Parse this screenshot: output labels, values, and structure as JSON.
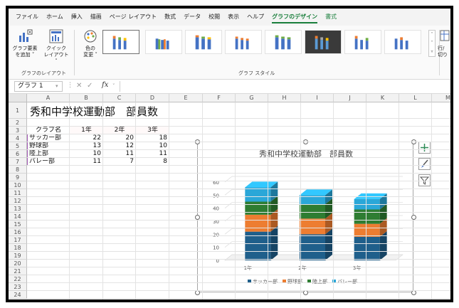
{
  "ribbon": {
    "tabs": [
      "ファイル",
      "ホーム",
      "挿入",
      "描画",
      "ページ レイアウト",
      "数式",
      "データ",
      "校閲",
      "表示",
      "ヘルプ",
      "グラフのデザイン",
      "書式"
    ],
    "active_tab": "グラフのデザイン",
    "buttons": {
      "add_element_l1": "グラフ要素",
      "add_element_l2": "を追加 ˅",
      "quick_layout_l1": "クイック",
      "quick_layout_l2": "レイアウト ˅",
      "change_color_l1": "色の",
      "change_color_l2": "変更 ˅",
      "switch_rowcol_l1": "行/",
      "switch_rowcol_l2": "切り"
    },
    "groups": {
      "layouts": "グラフのレイアウト",
      "styles": "グラフ スタイル"
    }
  },
  "formula_bar": {
    "name_box": "グラフ 1",
    "fx": "fx",
    "cancel": "✕",
    "confirm": "✓",
    "value": ""
  },
  "columns": [
    "A",
    "B",
    "C",
    "D",
    "E",
    "F",
    "G",
    "H",
    "I",
    "J",
    "K",
    "L",
    "M"
  ],
  "rows": [
    "1",
    "2",
    "3",
    "4",
    "5",
    "6",
    "7",
    "8",
    "9",
    "10",
    "11",
    "12",
    "13",
    "14",
    "15",
    "16",
    "17",
    "18",
    "19",
    "20",
    "21",
    "22",
    "23",
    "24"
  ],
  "sheet": {
    "title": "秀和中学校運動部　部員数",
    "header": [
      "クラブ名",
      "1年",
      "2年",
      "3年"
    ],
    "data": [
      {
        "club": "サッカー部",
        "y1": "22",
        "y2": "20",
        "y3": "18"
      },
      {
        "club": "野球部",
        "y1": "13",
        "y2": "12",
        "y3": "10"
      },
      {
        "club": "陸上部",
        "y1": "10",
        "y2": "11",
        "y3": "11"
      },
      {
        "club": "バレー部",
        "y1": "11",
        "y2": "7",
        "y3": "8"
      }
    ]
  },
  "chart_data": {
    "type": "bar",
    "stacked": true,
    "three_d": true,
    "title": "秀和中学校運動部　部員数",
    "categories": [
      "1年",
      "2年",
      "3年"
    ],
    "series": [
      {
        "name": "サッカー部",
        "values": [
          22,
          20,
          18
        ],
        "color": "#1f5f8b"
      },
      {
        "name": "野球部",
        "values": [
          13,
          12,
          10
        ],
        "color": "#ed7d31"
      },
      {
        "name": "陸上部",
        "values": [
          10,
          11,
          11
        ],
        "color": "#2e7d32"
      },
      {
        "name": "バレー部",
        "values": [
          11,
          7,
          8
        ],
        "color": "#2aa7d8"
      }
    ],
    "ylim": [
      0,
      60
    ],
    "yticks": [
      "0",
      "10",
      "20",
      "30",
      "40",
      "50",
      "60"
    ],
    "legend": "bottom",
    "grid": true
  },
  "colors": {
    "accent": "#1a7f3c"
  }
}
